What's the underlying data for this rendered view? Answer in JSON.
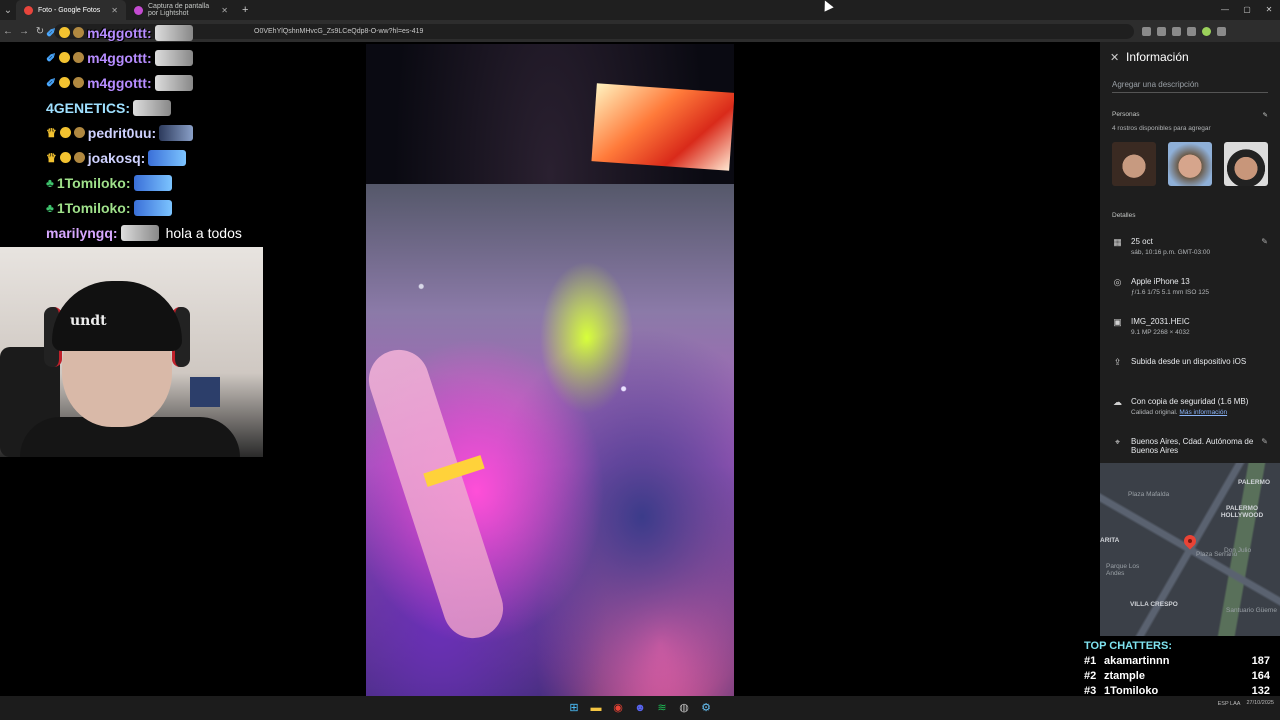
{
  "browser": {
    "tabs": [
      {
        "title": "Foto - Google Fotos",
        "active": true
      },
      {
        "title": "Captura de pantalla por Lightshot",
        "active": false
      }
    ],
    "new_tab": "+",
    "url": "O0VEhYlQshnMHvcG_Zs9LCeQdp8-O-ww?hl=es-419",
    "window_controls": [
      "—",
      "▢",
      "✕"
    ]
  },
  "chat": {
    "messages": [
      {
        "badges": [
          "pen",
          "one",
          "coin"
        ],
        "user": "m4ggottt:",
        "color": "#b68cff",
        "emote": "white",
        "text": ""
      },
      {
        "badges": [
          "pen",
          "one",
          "coin"
        ],
        "user": "m4ggottt:",
        "color": "#b68cff",
        "emote": "white",
        "text": ""
      },
      {
        "badges": [
          "pen",
          "one",
          "coin"
        ],
        "user": "m4ggottt:",
        "color": "#b68cff",
        "emote": "white",
        "text": ""
      },
      {
        "badges": [],
        "user": "4GENETICS:",
        "color": "#9fe0ff",
        "emote": "white",
        "text": ""
      },
      {
        "badges": [
          "crown",
          "one",
          "coin"
        ],
        "user": "pedrit0uu:",
        "color": "#cfd2ff",
        "emote": "dark",
        "text": ""
      },
      {
        "badges": [
          "crown",
          "one",
          "coin"
        ],
        "user": "joakosq:",
        "color": "#cfd2ff",
        "emote": "blue",
        "text": ""
      },
      {
        "badges": [
          "leaf"
        ],
        "user": "1Tomiloko:",
        "color": "#9fe08a",
        "emote": "blue",
        "text": ""
      },
      {
        "badges": [
          "leaf"
        ],
        "user": "1Tomiloko:",
        "color": "#9fe08a",
        "emote": "blue",
        "text": ""
      },
      {
        "badges": [],
        "user": "marilyngq:",
        "color": "#d7a8ff",
        "emote": "white",
        "text": "hola a todos"
      }
    ]
  },
  "webcam": {
    "beanie_text": "undt"
  },
  "info_panel": {
    "title": "Información",
    "description_placeholder": "Agregar una descripción",
    "people": {
      "heading": "Personas",
      "subtitle": "4 rostros disponibles para agregar"
    },
    "details_heading": "Detalles",
    "details": [
      {
        "icon": "calendar-icon",
        "glyph": "▦",
        "line1": "25 oct",
        "line2": "sáb, 10:16 p.m.   GMT-03:00",
        "link": "",
        "editable": true
      },
      {
        "icon": "camera-icon",
        "glyph": "◎",
        "line1": "Apple iPhone 13",
        "line2": "ƒ/1.6   1/75   5.1 mm   ISO 125",
        "link": "",
        "editable": false
      },
      {
        "icon": "image-icon",
        "glyph": "▣",
        "line1": "IMG_2031.HEIC",
        "line2": "9.1 MP   2268 × 4032",
        "link": "",
        "editable": false
      },
      {
        "icon": "upload-icon",
        "glyph": "⇪",
        "line1": "Subida desde un dispositivo iOS",
        "line2": "",
        "link": "",
        "editable": false
      },
      {
        "icon": "cloud-icon",
        "glyph": "☁",
        "line1": "Con copia de seguridad (1.6 MB)",
        "line2": "Calidad original. ",
        "link": "Más información",
        "editable": false
      },
      {
        "icon": "location-icon",
        "glyph": "⌖",
        "line1": "Buenos Aires, Cdad. Autónoma de Buenos Aires",
        "line2": "",
        "link": "",
        "editable": true
      }
    ],
    "map_labels": {
      "plaza_mafalda": "Plaza Mafalda",
      "palermo": "PALERMO",
      "palermo_hollywood": "PALERMO HOLLYWOOD",
      "parque": "Parque Los Andes",
      "arita": "ARITA",
      "plaza_serrano": "Plaza Serrano",
      "villa_crespo": "VILLA CRESPO",
      "julio": "Don Julio",
      "guemes": "Santuario Güeme"
    }
  },
  "top_chatters": {
    "title": "TOP CHATTERS:",
    "rows": [
      {
        "rank": "#1",
        "name": "akamartinnn",
        "count": "187"
      },
      {
        "rank": "#2",
        "name": "ztample",
        "count": "164"
      },
      {
        "rank": "#3",
        "name": "1Tomiloko",
        "count": "132"
      }
    ]
  },
  "taskbar": {
    "apps": [
      {
        "name": "windows-start-icon",
        "glyph": "⊞",
        "color": "#4cc2ff"
      },
      {
        "name": "file-explorer-icon",
        "glyph": "▬",
        "color": "#f4c542"
      },
      {
        "name": "chrome-icon",
        "glyph": "◉",
        "color": "#ea4335"
      },
      {
        "name": "discord-icon",
        "glyph": "☻",
        "color": "#5865f2"
      },
      {
        "name": "spotify-icon",
        "glyph": "≋",
        "color": "#1db954"
      },
      {
        "name": "obs-icon",
        "glyph": "◍",
        "color": "#bbbbbb"
      },
      {
        "name": "steam-icon",
        "glyph": "⚙",
        "color": "#66c0f4"
      }
    ],
    "lang": "ESP LAA",
    "date": "27/10/2025"
  }
}
